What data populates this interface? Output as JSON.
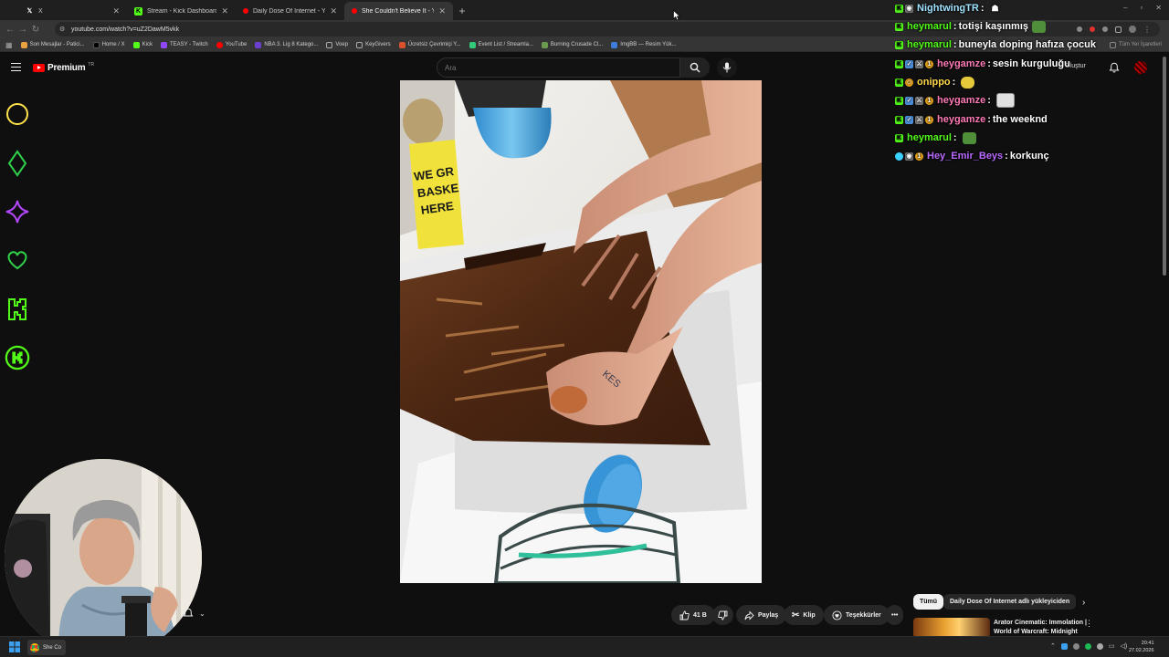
{
  "browser": {
    "tabs": [
      {
        "title": "X",
        "fav": "x-logo",
        "color": "#000000"
      },
      {
        "title": "Stream - Kick Dashboard",
        "fav": "kick-logo",
        "color": "#53fc18"
      },
      {
        "title": "Daily Dose Of Internet - YouTu...",
        "fav": "youtube-logo",
        "color": "#ff0000"
      },
      {
        "title": "She Couldn't Believe It - Yo...",
        "fav": "youtube-logo",
        "color": "#ff0000"
      }
    ],
    "url": "youtube.com/watch?v=uZ2DawM5vkk",
    "bookmarks": [
      {
        "label": "Son Mesajlar - Patici...",
        "color": "#e8a040"
      },
      {
        "label": "Home / X",
        "color": "#000000"
      },
      {
        "label": "Kick",
        "color": "#53fc18"
      },
      {
        "label": "TEASY - Twitch",
        "color": "#9146ff"
      },
      {
        "label": "YouTube",
        "color": "#ff0000"
      },
      {
        "label": "NBA 3. Lig 8 Katego...",
        "color": "#6b3fd0"
      },
      {
        "label": "Voep",
        "color": "#888888"
      },
      {
        "label": "KeyGivers",
        "color": "#888888"
      },
      {
        "label": "Ücretsiz Çevrimiçi Y...",
        "color": "#d8502e"
      },
      {
        "label": "Event List / Streamla...",
        "color": "#33c97a"
      },
      {
        "label": "Burning Crusade Cl...",
        "color": "#6b9a4f"
      },
      {
        "label": "ImgBB — Resim Yük...",
        "color": "#3d7cd8"
      }
    ],
    "bookmarks_right": "Tüm Yer İşaretleri"
  },
  "youtube": {
    "logo_text": "Premium",
    "logo_region": "TR",
    "search_placeholder": "Ara",
    "create_label": "Oluştur"
  },
  "chat": [
    {
      "user": "NightwingTR",
      "color": "#9fe3ff",
      "badges": [
        "kick",
        "sub"
      ],
      "text": "",
      "emote": "small-icon"
    },
    {
      "user": "heymarul",
      "color": "#53fc18",
      "badges": [
        "kick"
      ],
      "text": "totişi kaşınmış",
      "emote": "pepe-emote"
    },
    {
      "user": "heymarul",
      "color": "#53fc18",
      "badges": [
        "kick"
      ],
      "text": "buneyla doping hafıza çocuk",
      "emote": ""
    },
    {
      "user": "heygamze",
      "color": "#ff7ab6",
      "badges": [
        "kick",
        "verified",
        "sword",
        "coin"
      ],
      "text": "sesin kurguluğu",
      "emote": ""
    },
    {
      "user": "onippo",
      "color": "#ffd84a",
      "badges": [
        "kick",
        "sub"
      ],
      "text": "",
      "emote": "banana-emote"
    },
    {
      "user": "heygamze",
      "color": "#ff7ab6",
      "badges": [
        "kick",
        "verified",
        "sword",
        "coin"
      ],
      "text": "",
      "emote": "photo-emote"
    },
    {
      "user": "heygamze",
      "color": "#ff7ab6",
      "badges": [
        "kick",
        "verified",
        "sword",
        "coin"
      ],
      "text": "the weeknd",
      "emote": ""
    },
    {
      "user": "heymarul",
      "color": "#53fc18",
      "badges": [
        "kick"
      ],
      "text": "",
      "emote": "pepe-emote"
    },
    {
      "user": "Hey_Emir_Beys",
      "color": "#b96bff",
      "badges": [
        "gem",
        "sub",
        "coin"
      ],
      "text": "korkunç",
      "emote": ""
    }
  ],
  "actions": {
    "likes": "41 B",
    "share": "Paylaş",
    "clip": "Klip",
    "thanks": "Teşekkürler"
  },
  "chips": {
    "all": "Tümü",
    "uploader": "Daily Dose Of Internet adlı yükleyiciden"
  },
  "suggestion": {
    "title_line1": "Arator Cinematic: Immolation |",
    "title_line2": "World of Warcraft: Midnight"
  },
  "taskbar": {
    "app": "She Co",
    "time": "20:41",
    "date": "27.02.2026"
  },
  "overlay_icons": [
    "circle-icon",
    "diamond-icon",
    "sparkle-icon",
    "heart-icon",
    "kick-k-icon",
    "kick-coin-icon"
  ]
}
